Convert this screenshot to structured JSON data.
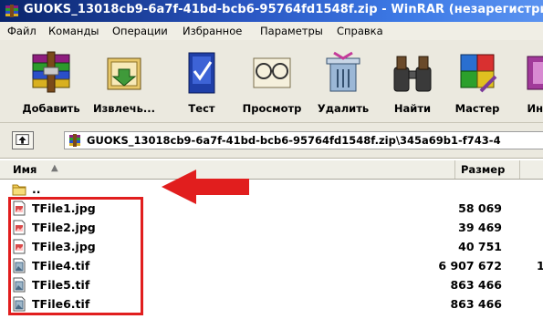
{
  "window": {
    "title": "GUOKS_13018cb9-6a7f-41bd-bcb6-95764fd1548f.zip - WinRAR (незарегистриро"
  },
  "menu": [
    "Файл",
    "Команды",
    "Операции",
    "Избранное",
    "Параметры",
    "Справка"
  ],
  "toolbar": [
    {
      "label": "Добавить",
      "icon": "add-archive-icon"
    },
    {
      "label": "Извлечь...",
      "icon": "extract-icon"
    },
    {
      "label": "Тест",
      "icon": "test-icon"
    },
    {
      "label": "Просмотр",
      "icon": "view-icon"
    },
    {
      "label": "Удалить",
      "icon": "delete-icon"
    },
    {
      "label": "Найти",
      "icon": "find-icon"
    },
    {
      "label": "Мастер",
      "icon": "wizard-icon"
    },
    {
      "label": "Инфо",
      "icon": "info-icon"
    }
  ],
  "path": {
    "text": "GUOKS_13018cb9-6a7f-41bd-bcb6-95764fd1548f.zip\\345a69b1-f743-4"
  },
  "columns": {
    "name": "Имя",
    "size": "Размер"
  },
  "parent_row": {
    "name": ".."
  },
  "files": [
    {
      "name": "TFile1.jpg",
      "size": "58 069",
      "type": "jpg"
    },
    {
      "name": "TFile2.jpg",
      "size": "39 469",
      "type": "jpg"
    },
    {
      "name": "TFile3.jpg",
      "size": "40 751",
      "type": "jpg"
    },
    {
      "name": "TFile4.tif",
      "size": "6 907 672",
      "type": "tif",
      "extra": "1"
    },
    {
      "name": "TFile5.tif",
      "size": "863 466",
      "type": "tif"
    },
    {
      "name": "TFile6.tif",
      "size": "863 466",
      "type": "tif"
    }
  ],
  "annotation": {
    "box_color": "#e11e1e",
    "arrow_color": "#e11e1e"
  }
}
